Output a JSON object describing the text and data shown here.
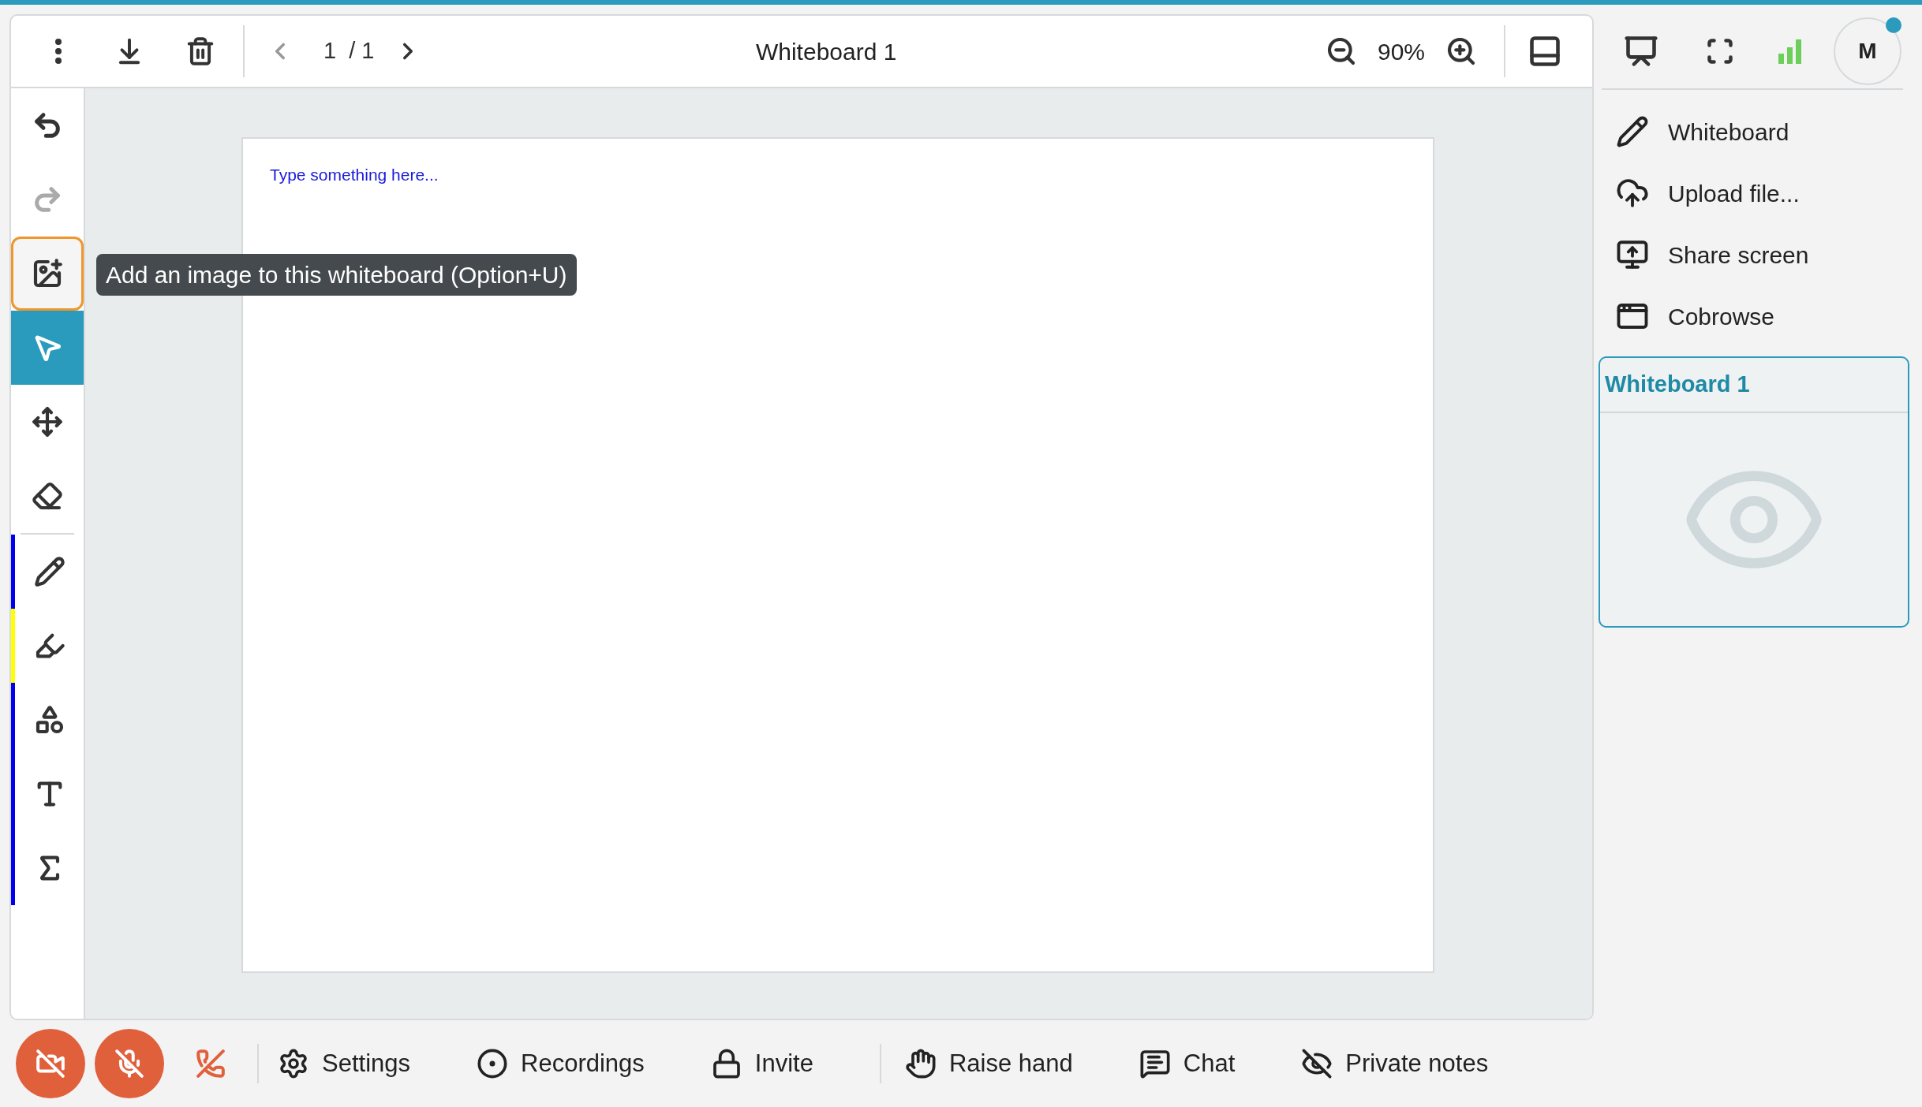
{
  "toolbar": {
    "page_current": "1",
    "page_total": "/ 1",
    "prev_disabled": true,
    "next_disabled": false,
    "title": "Whiteboard 1",
    "zoom": "90%"
  },
  "history": [
    {
      "kind": "undo",
      "disabled": false
    },
    {
      "kind": "redo",
      "disabled": true
    }
  ],
  "image_button": {
    "focused": true,
    "tooltip": "Add an image to this whiteboard (Option+U)"
  },
  "tools": [
    {
      "kind": "select",
      "selected": true
    },
    {
      "kind": "move",
      "selected": false
    },
    {
      "kind": "eraser",
      "selected": false
    },
    {
      "kind": "pencil",
      "selected": false,
      "color": "#0000ee"
    },
    {
      "kind": "highlighter",
      "selected": false,
      "color": "#ffff00"
    },
    {
      "kind": "shapes",
      "selected": false,
      "color": "#0000ee"
    },
    {
      "kind": "text",
      "selected": false,
      "color": "#0000ee"
    },
    {
      "kind": "formula",
      "selected": false,
      "color": "#0000ee"
    }
  ],
  "page": {
    "placeholder": "Type something here..."
  },
  "avatar": {
    "initial": "M",
    "online": true
  },
  "menu": [
    {
      "kind": "whiteboard",
      "label": "Whiteboard"
    },
    {
      "kind": "upload",
      "label": "Upload file..."
    },
    {
      "kind": "share",
      "label": "Share screen"
    },
    {
      "kind": "cobrowse",
      "label": "Cobrowse"
    }
  ],
  "card": {
    "title": "Whiteboard 1",
    "selected": true
  },
  "call_controls": [
    {
      "kind": "camera",
      "on": false
    },
    {
      "kind": "mic",
      "on": false
    },
    {
      "kind": "hangup"
    }
  ],
  "actions": [
    {
      "kind": "settings",
      "label": "Settings"
    },
    {
      "kind": "recordings",
      "label": "Recordings"
    },
    {
      "kind": "invite",
      "label": "Invite"
    },
    {
      "kind": "raise_hand",
      "label": "Raise hand"
    },
    {
      "kind": "chat",
      "label": "Chat"
    },
    {
      "kind": "private_notes",
      "label": "Private notes"
    }
  ]
}
